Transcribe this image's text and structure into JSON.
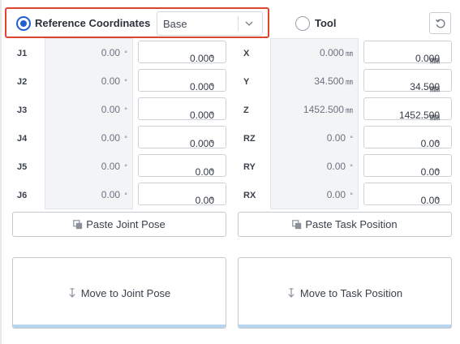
{
  "header": {
    "reference_label": "Reference Coordinates",
    "reference_selected": true,
    "reference_select_value": "Base",
    "tool_label": "Tool",
    "tool_selected": false
  },
  "joint_rows": [
    {
      "label": "J1",
      "current": "0.00",
      "input": "0.000",
      "unit": "°"
    },
    {
      "label": "J2",
      "current": "0.00",
      "input": "0.000",
      "unit": "°"
    },
    {
      "label": "J3",
      "current": "0.00",
      "input": "0.000",
      "unit": "°"
    },
    {
      "label": "J4",
      "current": "0.00",
      "input": "0.000",
      "unit": "°"
    },
    {
      "label": "J5",
      "current": "0.00",
      "input": "0.00",
      "unit": "°"
    },
    {
      "label": "J6",
      "current": "0.00",
      "input": "0.00",
      "unit": "°"
    }
  ],
  "task_rows": [
    {
      "label": "X",
      "current": "0.000",
      "input": "0.000",
      "unit": "㎜"
    },
    {
      "label": "Y",
      "current": "34.500",
      "input": "34.500",
      "unit": "㎜"
    },
    {
      "label": "Z",
      "current": "1452.500",
      "input": "1452.500",
      "unit": "㎜"
    },
    {
      "label": "RZ",
      "current": "0.00",
      "input": "0.00",
      "unit": "°"
    },
    {
      "label": "RY",
      "current": "0.00",
      "input": "0.00",
      "unit": "°"
    },
    {
      "label": "RX",
      "current": "0.00",
      "input": "0.00",
      "unit": "°"
    }
  ],
  "buttons": {
    "paste_joint": "Paste Joint Pose",
    "paste_task": "Paste Task Position",
    "move_joint": "Move to Joint Pose",
    "move_task": "Move to Task Position"
  },
  "icons": {
    "reset": "reset-icon",
    "paste": "paste-icon",
    "move": "move-down-arrow-icon",
    "dropdown": "chevron-down-icon"
  },
  "colors": {
    "accent": "#1f5fd6",
    "highlight_border": "#e0442f",
    "move_bar": "#b9d4ee"
  }
}
